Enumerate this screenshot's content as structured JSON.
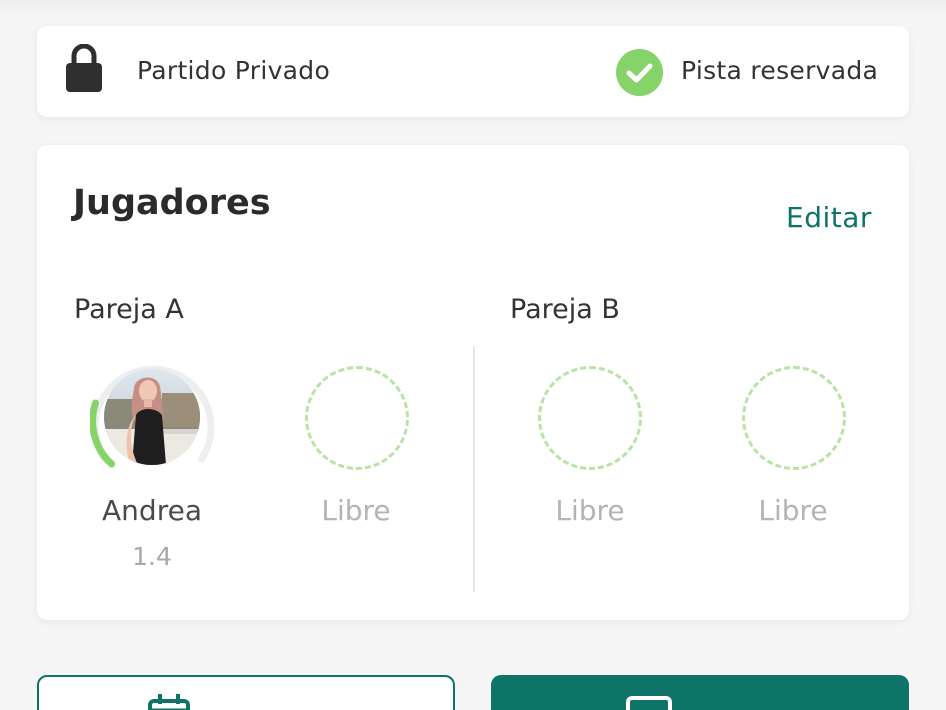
{
  "status": {
    "left_label": "Partido Privado",
    "left_icon": "lock-icon",
    "right_label": "Pista reservada",
    "right_icon": "check-circle-icon"
  },
  "players": {
    "title": "Jugadores",
    "edit_label": "Editar",
    "teams": [
      {
        "label": "Pareja A",
        "slots": [
          {
            "name": "Andrea",
            "level": "1.4",
            "level_ring_fraction": 0.2
          },
          {
            "name": "Libre"
          }
        ]
      },
      {
        "label": "Pareja B",
        "slots": [
          {
            "name": "Libre"
          },
          {
            "name": "Libre"
          }
        ]
      }
    ]
  },
  "bottom_actions": {
    "left_icon": "calendar-icon",
    "left_label": "",
    "right_icon": "screen-icon",
    "right_label": ""
  },
  "colors": {
    "accent": "#0f7468",
    "success": "#86d36a",
    "slot_dash": "#b9e3a4",
    "background": "#f5f5f5"
  }
}
